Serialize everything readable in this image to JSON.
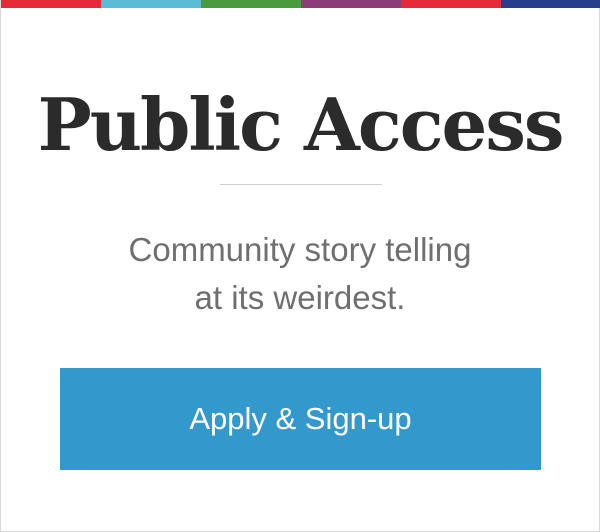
{
  "stripes": [
    "#e52b3a",
    "#5bbcd6",
    "#4a9a3e",
    "#8b3d7a",
    "#e52b3a",
    "#263f8c"
  ],
  "title": "Public Access",
  "tagline": {
    "line1": "Community story telling",
    "line2": "at its weirdest."
  },
  "cta": {
    "label": "Apply & Sign-up",
    "color": "#3399cc"
  }
}
